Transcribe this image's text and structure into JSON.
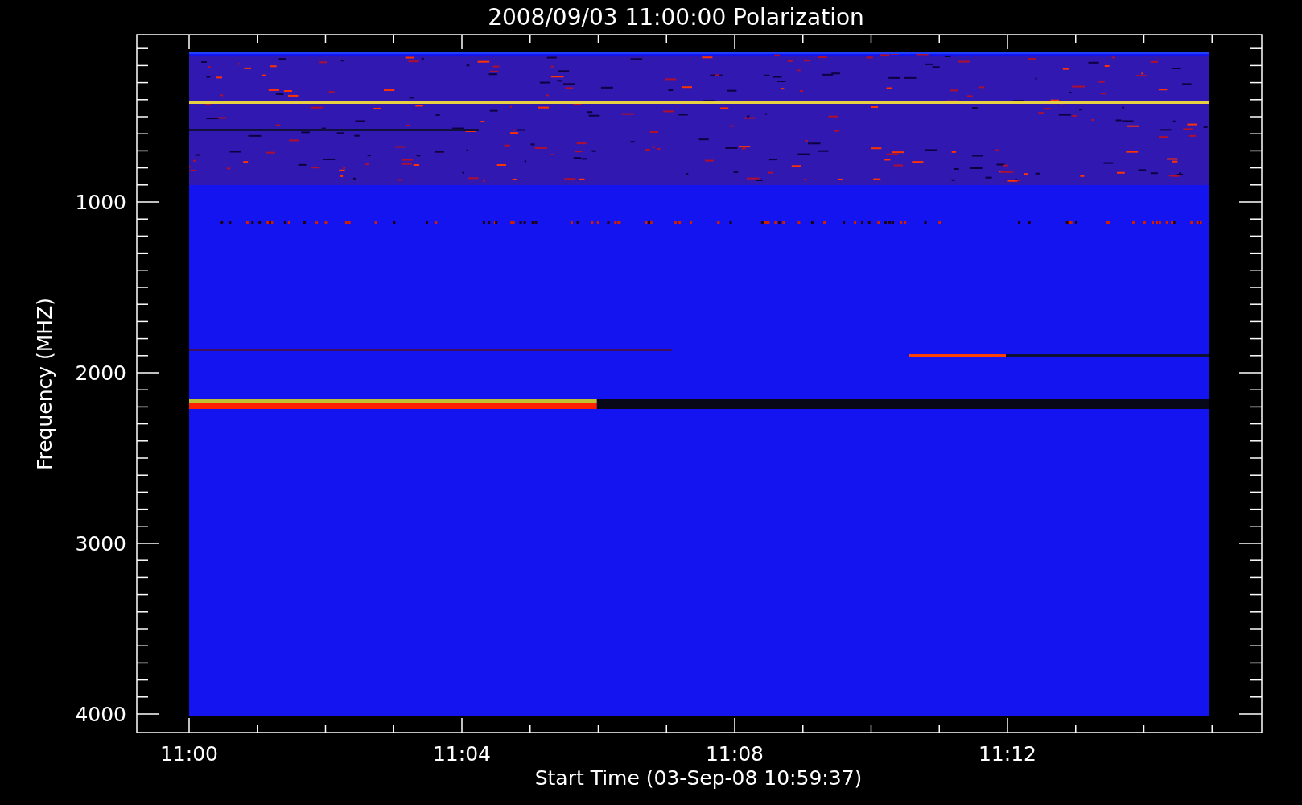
{
  "title": "2008/09/03 11:00:00 Polarization",
  "y_axis": {
    "label": "Frequency (MHZ)",
    "ticks": [
      "1000",
      "2000",
      "3000",
      "4000"
    ]
  },
  "x_axis": {
    "label": "Start Time (03-Sep-08 10:59:37)",
    "ticks": [
      "11:00",
      "11:04",
      "11:08",
      "11:12"
    ]
  }
}
